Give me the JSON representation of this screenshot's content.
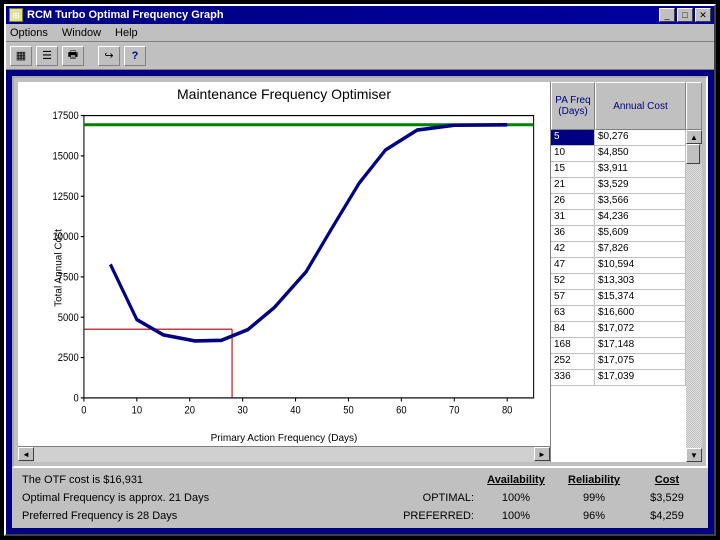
{
  "window": {
    "title": "RCM Turbo Optimal Frequency Graph"
  },
  "menus": {
    "options": "Options",
    "window": "Window",
    "help": "Help"
  },
  "chart": {
    "title": "Maintenance Frequency Optimiser",
    "ylabel": "Total Annual Cost",
    "xlabel": "Primary Action Frequency (Days)"
  },
  "chart_data": {
    "type": "line",
    "xlabel": "Primary Action Frequency (Days)",
    "ylabel": "Total Annual Cost",
    "title": "Maintenance Frequency Optimiser",
    "xlim": [
      0,
      85
    ],
    "ylim": [
      0,
      17500
    ],
    "xticks": [
      0,
      10,
      20,
      30,
      40,
      50,
      60,
      70,
      80
    ],
    "yticks": [
      0,
      2500,
      5000,
      7500,
      10000,
      12500,
      15000,
      17500
    ],
    "series": [
      {
        "name": "Annual Cost",
        "color": "#000080",
        "x": [
          5,
          10,
          15,
          21,
          26,
          31,
          36,
          42,
          47,
          52,
          57,
          63,
          70,
          80
        ],
        "values": [
          8276,
          4850,
          3911,
          3529,
          3566,
          4236,
          5609,
          7826,
          10594,
          13303,
          15374,
          16600,
          16900,
          16931
        ]
      }
    ],
    "marker_vertical_x": 28,
    "marker_horizontal_y": 4259,
    "hline_value": 16931,
    "hline_color": "#008000"
  },
  "table": {
    "head1": "PA Freq (Days)",
    "head2": "Annual Cost",
    "rows": [
      {
        "freq": "5",
        "cost": "$0,276"
      },
      {
        "freq": "10",
        "cost": "$4,850"
      },
      {
        "freq": "15",
        "cost": "$3,911"
      },
      {
        "freq": "21",
        "cost": "$3,529"
      },
      {
        "freq": "26",
        "cost": "$3,566"
      },
      {
        "freq": "31",
        "cost": "$4,236"
      },
      {
        "freq": "36",
        "cost": "$5,609"
      },
      {
        "freq": "42",
        "cost": "$7,826"
      },
      {
        "freq": "47",
        "cost": "$10,594"
      },
      {
        "freq": "52",
        "cost": "$13,303"
      },
      {
        "freq": "57",
        "cost": "$15,374"
      },
      {
        "freq": "63",
        "cost": "$16,600"
      },
      {
        "freq": "84",
        "cost": "$17,072"
      },
      {
        "freq": "168",
        "cost": "$17,148"
      },
      {
        "freq": "252",
        "cost": "$17,075"
      },
      {
        "freq": "336",
        "cost": "$17,039"
      }
    ],
    "selected_index": 0
  },
  "summary": {
    "otf_label": "The OTF cost is $16,931",
    "optfreq_label": "Optimal Frequency is approx. 21 Days",
    "preffreq_label": "Preferred Frequency is 28 Days",
    "col_optimal": "OPTIMAL:",
    "col_preferred": "PREFERRED:",
    "hdr_avail": "Availability",
    "hdr_rel": "Reliability",
    "hdr_cost": "Cost",
    "opt_avail": "100%",
    "opt_rel": "99%",
    "opt_cost": "$3,529",
    "pref_avail": "100%",
    "pref_rel": "96%",
    "pref_cost": "$4,259"
  }
}
